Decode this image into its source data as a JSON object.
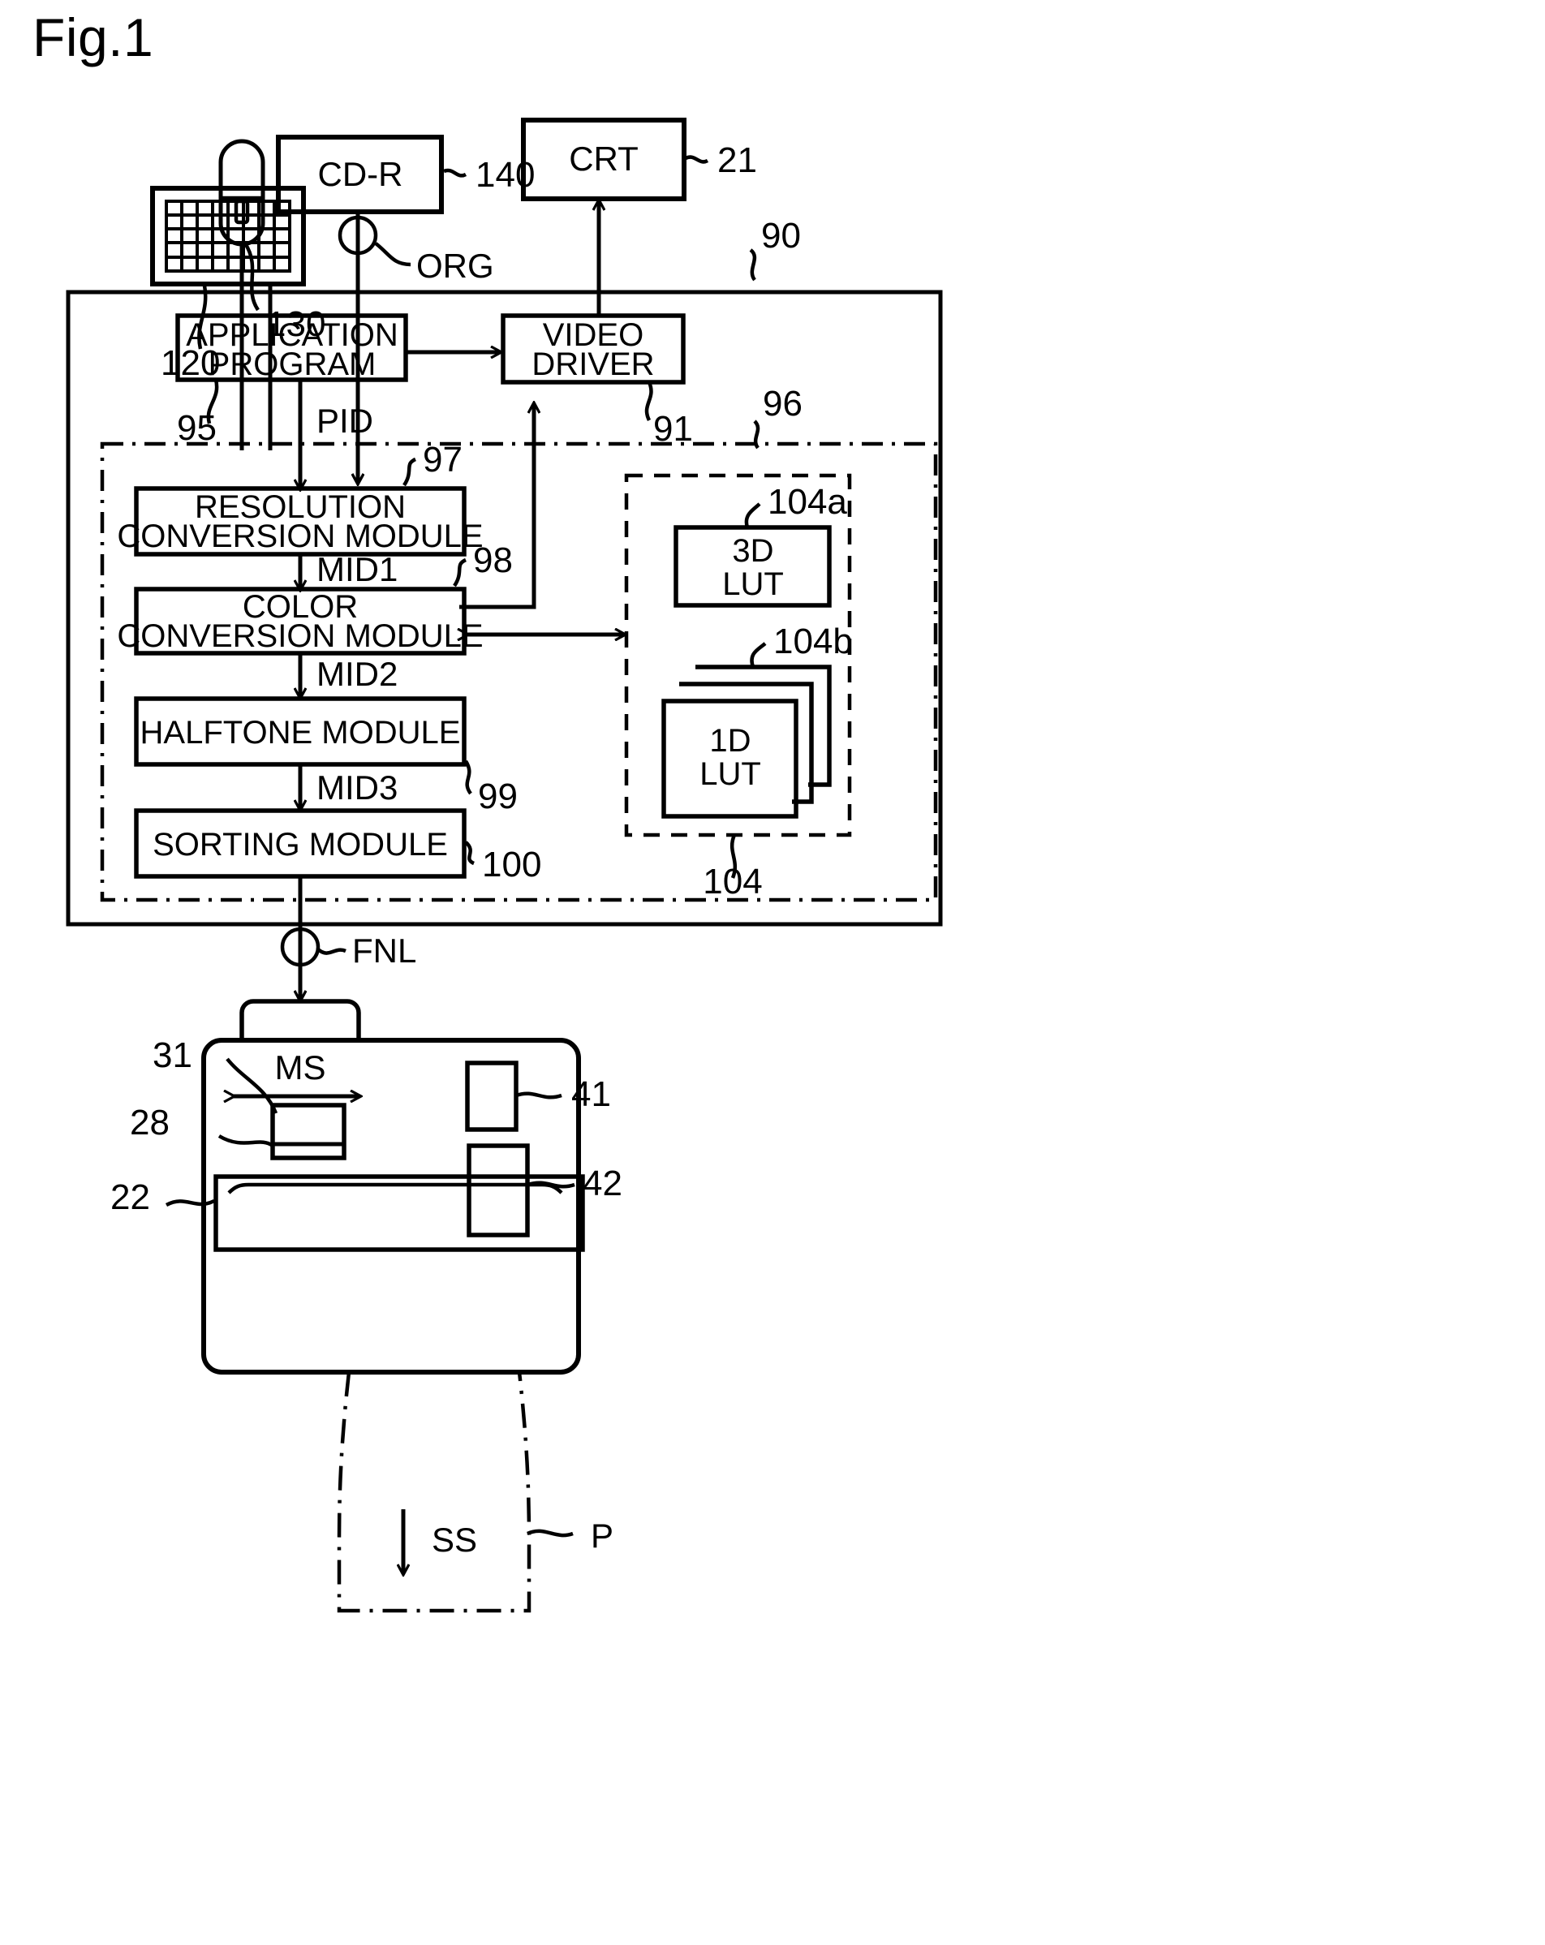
{
  "figure": {
    "title": "Fig.1",
    "type": "patent-block-diagram"
  },
  "devices": {
    "keyboard": {
      "ref": "120",
      "name": "keyboard"
    },
    "mouse": {
      "ref": "130",
      "name": "mouse"
    },
    "cdr": {
      "label": "CD-R",
      "ref": "140"
    },
    "crt": {
      "label": "CRT",
      "ref": "21"
    }
  },
  "computer": {
    "ref": "90",
    "blocks": {
      "application_program": {
        "line1": "APPLICATION",
        "line2": "PROGRAM",
        "ref": "95"
      },
      "video_driver": {
        "line1": "VIDEO",
        "line2": "DRIVER",
        "ref": "91"
      }
    },
    "printer_driver": {
      "ref": "96",
      "modules": [
        {
          "line1": "RESOLUTION",
          "line2": "CONVERSION MODULE",
          "ref": "97"
        },
        {
          "line1": "COLOR",
          "line2": "CONVERSION MODULE",
          "ref": "98"
        },
        {
          "line1": "HALFTONE MODULE",
          "line2": "",
          "ref": "99"
        },
        {
          "line1": "SORTING MODULE",
          "line2": "",
          "ref": "100"
        }
      ],
      "lut_group": {
        "ref": "104",
        "tables": [
          {
            "line1": "3D",
            "line2": "LUT",
            "ref": "104a"
          },
          {
            "line1": "1D",
            "line2": "LUT",
            "ref": "104b"
          }
        ]
      }
    }
  },
  "signals": {
    "org": "ORG",
    "pid": "PID",
    "mid1": "MID1",
    "mid2": "MID2",
    "mid3": "MID3",
    "fnl": "FNL"
  },
  "printer": {
    "main_scan": "MS",
    "sub_scan": "SS",
    "paper": "P",
    "refs": {
      "carriage": "31",
      "head": "28",
      "platen": "22",
      "cartridge_upper": "41",
      "cartridge_lower": "42"
    }
  }
}
